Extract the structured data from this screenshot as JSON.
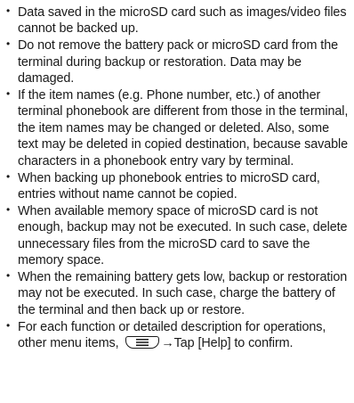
{
  "notes": [
    "Data saved in the microSD card such as images/video files cannot be backed up.",
    "Do not remove the battery pack or microSD card from the terminal during backup or restoration. Data may be damaged.",
    "If the item names (e.g. Phone number, etc.) of another terminal phonebook are different from those in the terminal, the item names may be changed or deleted. Also, some text may be deleted in copied destination, because savable characters in a phonebook entry vary by terminal.",
    "When backing up phonebook entries to microSD card, entries without name cannot be copied.",
    "When available memory space of microSD card is not enough, backup may not be executed. In such case, delete unnecessary files from the microSD card to save the memory space.",
    "When the remaining battery gets low, backup or restoration may not be executed. In such case, charge the battery of the terminal and then back up or restore."
  ],
  "last_note": {
    "before_key": "For each function or detailed description for operations, other menu items,",
    "key_icon": "menu-key-icon",
    "after_key": "→Tap [Help] to confirm."
  }
}
